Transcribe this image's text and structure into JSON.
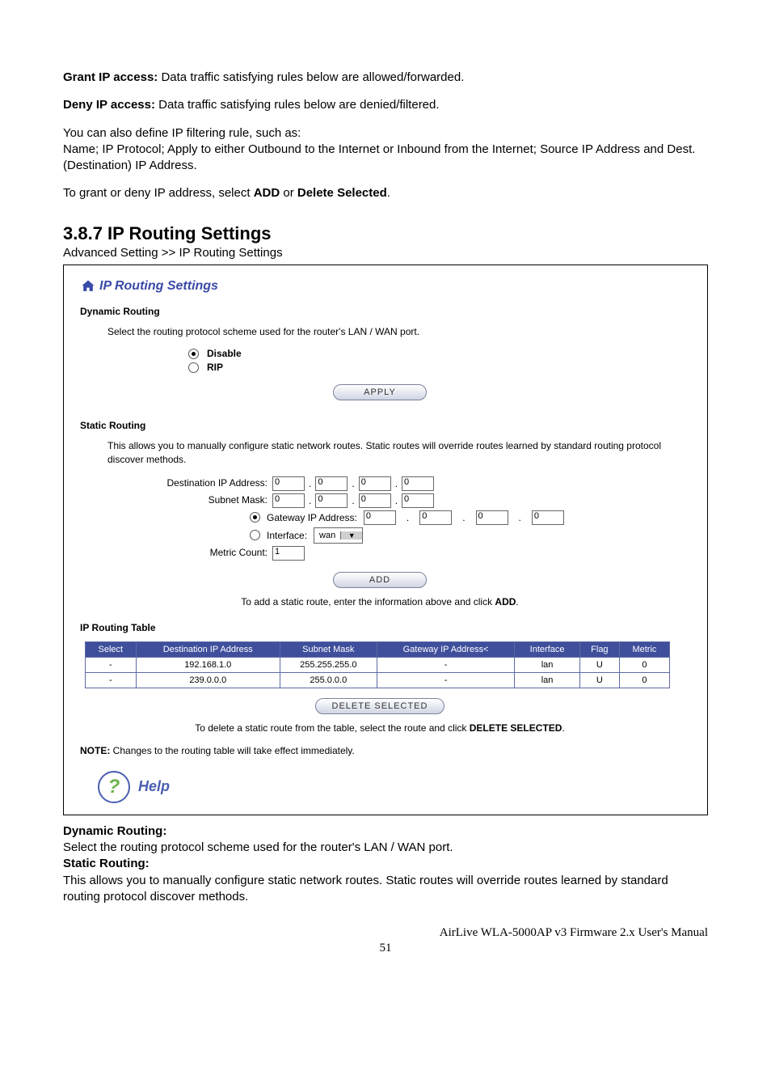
{
  "intro": {
    "grant_label": "Grant IP access:",
    "grant_text": " Data traffic satisfying rules below are allowed/forwarded.",
    "deny_label": "Deny IP access:",
    "deny_text": " Data traffic satisfying rules below are denied/filtered.",
    "define1": "You can also define IP filtering rule, such as:",
    "define2": "Name; IP Protocol; Apply to either Outbound to the Internet or Inbound from the Internet; Source IP Address and Dest. (Destination) IP Address.",
    "grantdeny1": "To grant or deny IP address, select ",
    "add_word": "ADD",
    "or_word": " or ",
    "del_word": "Delete Selected",
    "period": "."
  },
  "section": {
    "title": "3.8.7 IP Routing Settings",
    "breadcrumb": "Advanced Setting >> IP Routing Settings"
  },
  "panel": {
    "title": "IP Routing Settings",
    "dynamic": {
      "heading": "Dynamic Routing",
      "desc": "Select the routing protocol scheme used for the router's LAN / WAN port.",
      "opt_disable": "Disable",
      "opt_rip": "RIP",
      "apply": "APPLY"
    },
    "static": {
      "heading": "Static Routing",
      "desc": "This allows you to manually configure static network routes. Static routes will override routes learned by standard routing protocol discover methods.",
      "dest_label": "Destination IP Address:",
      "mask_label": "Subnet Mask:",
      "gw_label": "Gateway IP Address:",
      "iface_label": "Interface:",
      "iface_value": "wan",
      "metric_label": "Metric Count:",
      "metric_value": "1",
      "ip0": "0",
      "add": "ADD",
      "add_hint_pre": "To add a static route, enter the information above and click ",
      "add_hint_bold": "ADD",
      "add_hint_post": "."
    },
    "table": {
      "heading": "IP Routing Table",
      "cols": {
        "select": "Select",
        "dest": "Destination IP Address",
        "mask": "Subnet Mask",
        "gw": "Gateway IP Address<",
        "iface": "Interface",
        "flag": "Flag",
        "metric": "Metric"
      },
      "rows": [
        {
          "select": "-",
          "dest": "192.168.1.0",
          "mask": "255.255.255.0",
          "gw": "-",
          "iface": "lan",
          "flag": "U",
          "metric": "0"
        },
        {
          "select": "-",
          "dest": "239.0.0.0",
          "mask": "255.0.0.0",
          "gw": "-",
          "iface": "lan",
          "flag": "U",
          "metric": "0"
        }
      ],
      "del_btn": "DELETE SELECTED",
      "del_hint_pre": "To delete a static route from the table, select the route and click ",
      "del_hint_bold": "DELETE SELECTED",
      "del_hint_post": "."
    },
    "note_label": "NOTE:",
    "note_text": " Changes to the routing table will take effect immediately.",
    "help": "Help"
  },
  "after": {
    "dyn_label": "Dynamic Routing:",
    "dyn_text": "Select the routing protocol scheme used for the router's LAN / WAN port.",
    "stat_label": "Static Routing:",
    "stat_text": "This allows you to manually configure static network routes. Static routes will override routes learned by standard routing protocol discover methods."
  },
  "footer": {
    "product": "AirLive WLA-5000AP v3 Firmware 2.x User's Manual",
    "page": "51"
  }
}
